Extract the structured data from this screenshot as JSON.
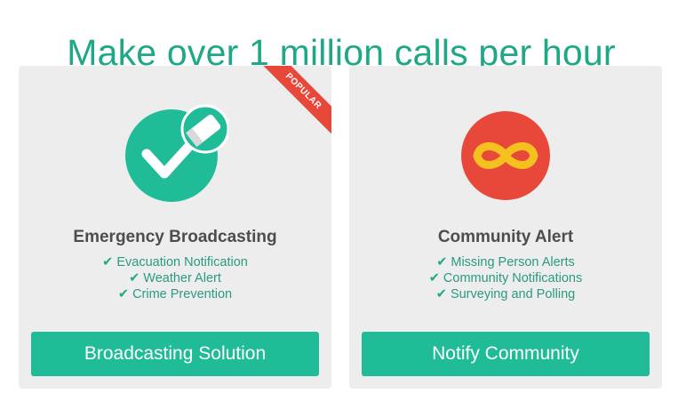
{
  "headline": "Make over 1 million calls per hour",
  "colors": {
    "brand_green": "#1fbc97",
    "heading_green": "#1ea887",
    "ribbon_red": "#e8483a",
    "infinity_yellow": "#f5c11e"
  },
  "cards": [
    {
      "title": "Emergency Broadcasting",
      "icon": "check-badge-icon",
      "ribbon": "POPULAR",
      "features": [
        "Evacuation Notification",
        "Weather Alert",
        "Crime Prevention"
      ],
      "button_label": "Broadcasting Solution"
    },
    {
      "title": "Community Alert",
      "icon": "infinity-icon",
      "features": [
        "Missing Person Alerts",
        "Community Notifications",
        "Surveying and Polling"
      ],
      "button_label": "Notify Community"
    }
  ]
}
